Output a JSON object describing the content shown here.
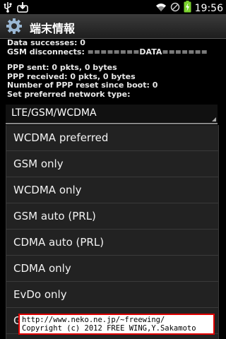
{
  "status_bar": {
    "time": "19:56",
    "icons": [
      "usb-icon",
      "download-icon",
      "wifi-icon",
      "no-sim-icon",
      "battery-charging-icon"
    ]
  },
  "title_bar": {
    "icon": "settings-gear-icon",
    "title": "端末情報"
  },
  "info": {
    "data_successes": "Data successes: 0",
    "gsm_disconnects": "GSM disconnects: ========DATA=======",
    "ppp_sent": "PPP sent: 0 pkts, 0 bytes",
    "ppp_received": "PPP received: 0 pkts, 0 bytes",
    "ppp_reset": "Number of PPP reset since boot: 0",
    "preferred_label": "Set preferred network type:"
  },
  "spinner": {
    "selected": "LTE/GSM/WCDMA"
  },
  "dropdown": {
    "options": [
      "WCDMA preferred",
      "GSM only",
      "WCDMA only",
      "GSM auto (PRL)",
      "CDMA auto (PRL)",
      "CDMA only",
      "EvDo only",
      "GSM/CDMA auto (PRL)"
    ]
  },
  "watermark": {
    "line1": "http://www.neko.ne.jp/~freewing/",
    "line2": "Copyright (c) 2012 FREE WING,Y.Sakamoto"
  },
  "colors": {
    "background": "#000000",
    "dropdown_bg": "#222222",
    "watermark_border": "#e00000",
    "battery_green": "#7bd32e"
  }
}
